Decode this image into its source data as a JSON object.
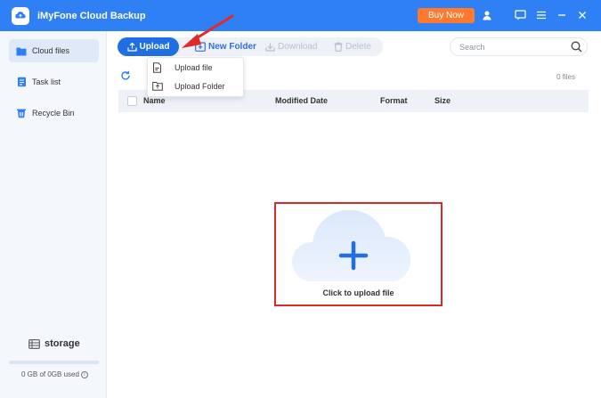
{
  "app": {
    "title": "iMyFone Cloud Backup"
  },
  "titlebar": {
    "buy_label": "Buy Now"
  },
  "sidebar": {
    "items": [
      {
        "label": "Cloud files",
        "icon": "folder-icon",
        "active": true
      },
      {
        "label": "Task list",
        "icon": "task-list-icon",
        "active": false
      },
      {
        "label": "Recycle Bin",
        "icon": "recycle-bin-icon",
        "active": false
      }
    ],
    "storage": {
      "title": "storage",
      "used": "0 GB of 0GB used",
      "fraction": 0
    }
  },
  "toolbar": {
    "upload_label": "Upload",
    "new_folder_label": "New Folder",
    "download_label": "Download",
    "delete_label": "Delete"
  },
  "search": {
    "placeholder": "Search",
    "value": ""
  },
  "upload_menu": {
    "items": [
      "Upload file",
      "Upload Folder"
    ]
  },
  "file_list": {
    "count": "0 files",
    "columns": [
      "Name",
      "Modified Date",
      "Format",
      "Size"
    ],
    "empty_prompt": "Click to upload file"
  },
  "colors": {
    "accent": "#2f80f5",
    "buy": "#ff7a2e",
    "highlight": "#d62b2b"
  }
}
